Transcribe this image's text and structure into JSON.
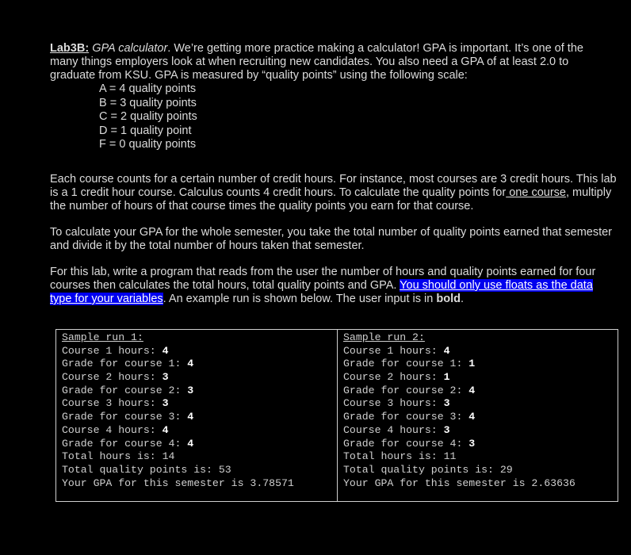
{
  "intro": {
    "title": "Lab3B:",
    "name": "GPA calculator",
    "body": ". We’re getting more practice making a calculator! GPA is important. It’s one of the many things employers look at when recruiting new candidates. You also need a GPA of at least 2.0 to graduate from KSU. GPA is measured by “quality points” using the following scale:"
  },
  "scale": [
    "A = 4 quality points",
    "B = 3 quality points",
    "C = 2 quality points",
    "D = 1 quality point",
    "F = 0 quality points"
  ],
  "credit_para": {
    "before": "Each course counts for a certain number of credit hours. For instance, most courses are 3 credit hours. This lab is a 1 credit hour course. Calculus counts 4 credit hours. To calculate the quality points for",
    "underlined": " one course",
    "after": ", multiply the number of hours of that course times the quality points you earn for that course."
  },
  "semester_para": "To calculate your GPA for the whole semester, you take the total number of quality points earned that semester and divide it by the total number of hours taken that semester.",
  "task_para": {
    "before": "For this lab, write a program that reads from the user the number of hours and quality points earned for four courses then calculates the total hours, total quality points and GPA. ",
    "highlight": "You should only use floats as the data type for your variables",
    "middle": ". An example run is shown below. The user input is in ",
    "bold": "bold",
    "end": "."
  },
  "samples": [
    {
      "header": "Sample run 1:",
      "lines": [
        {
          "label": "Course 1 hours: ",
          "value": "4"
        },
        {
          "label": "Grade for course 1: ",
          "value": "4"
        },
        {
          "label": "Course 2 hours: ",
          "value": "3"
        },
        {
          "label": "Grade for course 2: ",
          "value": "3"
        },
        {
          "label": "Course 3 hours: ",
          "value": "3"
        },
        {
          "label": "Grade for course 3: ",
          "value": "4"
        },
        {
          "label": "Course 4 hours: ",
          "value": "4"
        },
        {
          "label": "Grade for course 4: ",
          "value": "4"
        }
      ],
      "outputs": [
        "Total hours is: 14",
        "Total quality points is: 53",
        "Your GPA for this semester is 3.78571"
      ]
    },
    {
      "header": "Sample run 2:",
      "lines": [
        {
          "label": "Course 1 hours: ",
          "value": "4"
        },
        {
          "label": "Grade for course 1: ",
          "value": "1"
        },
        {
          "label": "Course 2 hours: ",
          "value": "1"
        },
        {
          "label": "Grade for course 2: ",
          "value": "4"
        },
        {
          "label": "Course 3 hours: ",
          "value": "3"
        },
        {
          "label": "Grade for course 3: ",
          "value": "4"
        },
        {
          "label": "Course 4 hours: ",
          "value": "3"
        },
        {
          "label": "Grade for course 4: ",
          "value": "3"
        }
      ],
      "outputs": [
        "Total hours is: 11",
        "Total quality points is: 29",
        "Your GPA for this semester is 2.63636"
      ]
    }
  ]
}
